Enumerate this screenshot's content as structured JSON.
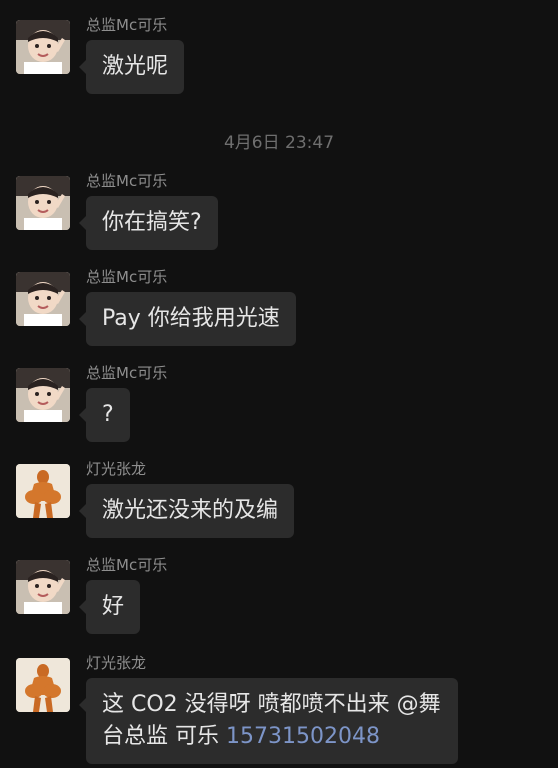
{
  "timestamp": "4月6日 23:47",
  "colors": {
    "background": "#111111",
    "bubble": "#2c2c2c",
    "bubble_text": "#e6e6e6",
    "sender_text": "#8e8e8e",
    "link": "#7d95c8"
  },
  "messages": [
    {
      "sender": "总监Mc可乐",
      "text": "激光呢",
      "avatar": "child-photo-avatar"
    },
    {
      "sender": "总监Mc可乐",
      "text": "你在搞笑?",
      "avatar": "child-photo-avatar"
    },
    {
      "sender": "总监Mc可乐",
      "text": "Pay 你给我用光速",
      "avatar": "child-photo-avatar"
    },
    {
      "sender": "总监Mc可乐",
      "text": "?",
      "avatar": "child-photo-avatar"
    },
    {
      "sender": "灯光张龙",
      "text": "激光还没来的及编",
      "avatar": "figure-avatar"
    },
    {
      "sender": "总监Mc可乐",
      "text": "好",
      "avatar": "child-photo-avatar"
    },
    {
      "sender": "灯光张龙",
      "text": "这 CO2 没得呀 喷都喷不出来 @舞台总监 可乐",
      "link": "15731502048",
      "avatar": "figure-avatar"
    }
  ]
}
